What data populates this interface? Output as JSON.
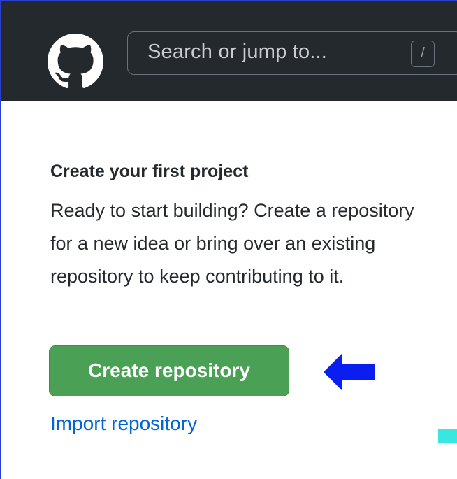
{
  "header": {
    "logo_icon": "github-octocat-icon",
    "search": {
      "placeholder": "Search or jump to...",
      "shortcut_key": "/"
    }
  },
  "empty_state": {
    "title": "Create your first project",
    "description": "Ready to start building? Create a repository for a new idea or bring over an existing repository to keep contributing to it.",
    "create_button_label": "Create repository",
    "import_link_label": "Import repository"
  },
  "annotation": {
    "arrow_icon": "arrow-left-icon",
    "arrow_color": "#0a1ef0"
  },
  "colors": {
    "header_bg": "#24292e",
    "primary_button": "#4aa155",
    "link": "#0366d6"
  }
}
